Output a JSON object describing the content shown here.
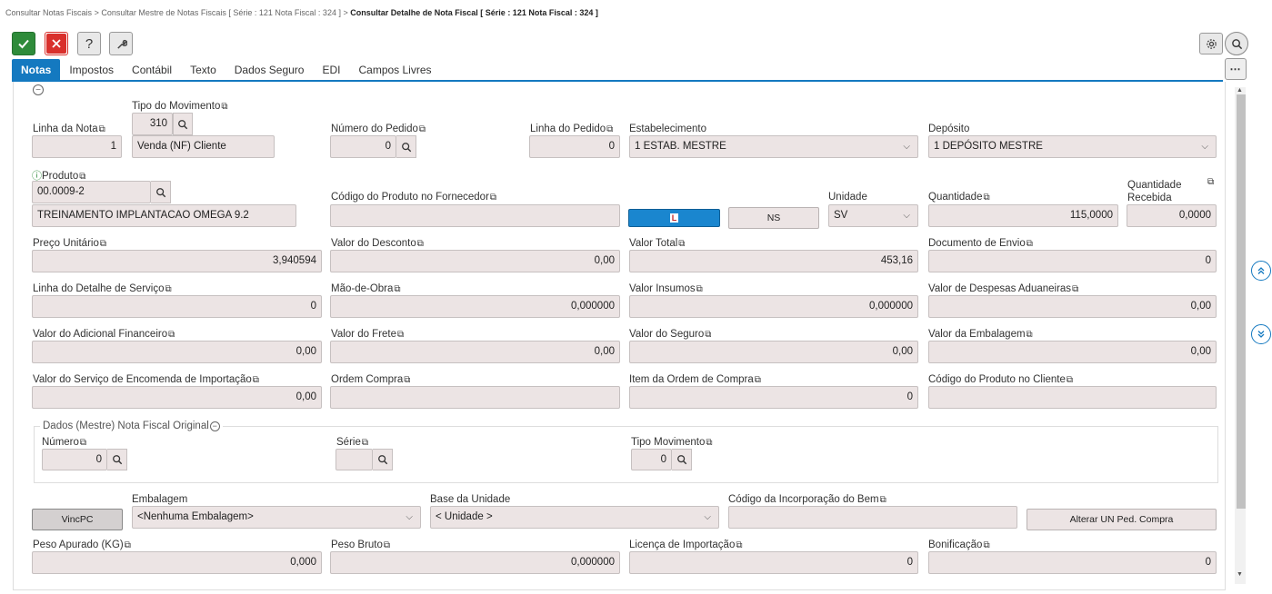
{
  "breadcrumb": {
    "item1": "Consultar Notas Fiscais",
    "sep": ">",
    "item2": "Consultar Mestre de Notas Fiscais [ Série : 121 Nota Fiscal : 324 ]",
    "item3": "Consultar Detalhe de Nota Fiscal [ Série : 121 Nota Fiscal : 324 ]"
  },
  "toolbar": {
    "confirm_icon": "check-icon",
    "cancel_icon": "close-icon",
    "help_icon": "question-icon",
    "tools_icon": "wrench-icon",
    "help_glyph": "?"
  },
  "tabs": [
    {
      "label": "Notas",
      "active": true
    },
    {
      "label": "Impostos"
    },
    {
      "label": "Contábil"
    },
    {
      "label": "Texto"
    },
    {
      "label": "Dados Seguro"
    },
    {
      "label": "EDI"
    },
    {
      "label": "Campos Livres"
    }
  ],
  "form": {
    "linha_nota": {
      "label": "Linha da Nota",
      "value": "1"
    },
    "tipo_movimento": {
      "label": "Tipo do Movimento",
      "code": "310",
      "desc": "Venda (NF) Cliente"
    },
    "numero_pedido": {
      "label": "Número do Pedido",
      "value": "0"
    },
    "linha_pedido": {
      "label": "Linha do Pedido",
      "value": "0"
    },
    "estabelecimento": {
      "label": "Estabelecimento",
      "value": "1 ESTAB. MESTRE"
    },
    "deposito": {
      "label": "Depósito",
      "value": "1 DEPÓSITO MESTRE"
    },
    "produto": {
      "label": "Produto",
      "code": "00.0009-2",
      "desc": "TREINAMENTO IMPLANTACAO OMEGA 9.2"
    },
    "codigo_fornecedor": {
      "label": "Código do Produto no Fornecedor",
      "value": ""
    },
    "btn_l": "L",
    "btn_ns": "NS",
    "unidade": {
      "label": "Unidade",
      "value": "SV"
    },
    "quantidade": {
      "label": "Quantidade",
      "value": "115,0000"
    },
    "quantidade_recebida": {
      "label1": "Quantidade",
      "label2": "Recebida",
      "value": "0,0000"
    },
    "preco_unitario": {
      "label": "Preço Unitário",
      "value": "3,940594"
    },
    "valor_desconto": {
      "label": "Valor do Desconto",
      "value": "0,00"
    },
    "valor_total": {
      "label": "Valor Total",
      "value": "453,16"
    },
    "documento_envio": {
      "label": "Documento de Envio",
      "value": "0"
    },
    "linha_detalhe_servico": {
      "label": "Linha do Detalhe de Serviço",
      "value": "0"
    },
    "mao_obra": {
      "label": "Mão-de-Obra",
      "value": "0,000000"
    },
    "valor_insumos": {
      "label": "Valor Insumos",
      "value": "0,000000"
    },
    "valor_despesas_aduaneiras": {
      "label": "Valor de Despesas Aduaneiras",
      "value": "0,00"
    },
    "valor_adicional_financeiro": {
      "label": "Valor do Adicional Financeiro",
      "value": "0,00"
    },
    "valor_frete": {
      "label": "Valor do Frete",
      "value": "0,00"
    },
    "valor_seguro": {
      "label": "Valor do Seguro",
      "value": "0,00"
    },
    "valor_embalagem": {
      "label": "Valor da Embalagem",
      "value": "0,00"
    },
    "valor_servico_encomenda": {
      "label": "Valor do Serviço de Encomenda de Importação",
      "value": "0,00"
    },
    "ordem_compra": {
      "label": "Ordem Compra",
      "value": ""
    },
    "item_ordem_compra": {
      "label": "Item da Ordem de Compra",
      "value": "0"
    },
    "codigo_produto_cliente": {
      "label": "Código do Produto no Cliente",
      "value": ""
    },
    "nf_original": {
      "legend": "Dados (Mestre) Nota Fiscal Original",
      "numero": {
        "label": "Número",
        "value": "0"
      },
      "serie": {
        "label": "Série",
        "value": ""
      },
      "tipo_movimento": {
        "label": "Tipo Movimento",
        "value": "0"
      }
    },
    "btn_vincpc": "VincPC",
    "embalagem": {
      "label": "Embalagem",
      "value": "<Nenhuma Embalagem>"
    },
    "base_unidade": {
      "label": "Base da Unidade",
      "value": "< Unidade >"
    },
    "codigo_incorporacao": {
      "label": "Código da Incorporação do Bem",
      "value": ""
    },
    "btn_alterar_un": "Alterar UN Ped. Compra",
    "peso_apurado": {
      "label": "Peso Apurado (KG)",
      "value": "0,000"
    },
    "peso_bruto": {
      "label": "Peso Bruto",
      "value": "0,000000"
    },
    "licenca_importacao": {
      "label": "Licença de Importação",
      "value": "0"
    },
    "bonificacao": {
      "label": "Bonificação",
      "value": "0"
    }
  },
  "colors": {
    "accent": "#1479c0",
    "confirm": "#2e8b3a",
    "cancel": "#d9302c",
    "field_bg": "#ece4e4"
  }
}
